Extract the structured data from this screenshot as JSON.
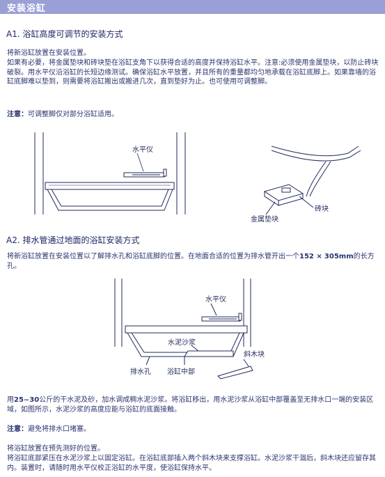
{
  "header": {
    "title": "安装浴缸"
  },
  "sectionA1": {
    "heading": "A1. 浴缸高度可调节的安装方式",
    "p1": "将新浴缸放置在安装位置。",
    "p2": "如果有必要，将金属垫块和砖块垫在浴缸支角下以获得合适的高度并保持浴缸水平。注意:必须使用金属垫块，以防止砖块破裂。用水平仪沿浴缸的长短边缘测试。确保浴缸水平放置，并且所有的重量都均匀地承载在浴缸底脚上。如果靠墙的浴缸底脚难以垫到，则需要将浴缸搬出或搬进几次，直到垫好为止。也可使用可调整脚。",
    "note_label": "注意：",
    "note_text": "可调整脚仅对部分浴缸适用。",
    "fig_label_level": "水平仪",
    "fig_label_brick": "砖块",
    "fig_label_metal_pad": "金属垫块"
  },
  "sectionA2": {
    "heading": "A2. 排水管通过地面的浴缸安装方式",
    "p1_a": "将新浴缸放置在安装位置以了解排水孔和浴缸底脚的位置。在地面合适的位置为排水管开出一个",
    "p1_dim1": "152 ×",
    "p1_dim2": "305mm",
    "p1_b": "的长方孔。",
    "fig_label_level": "水平仪",
    "fig_label_mortar": "水泥沙浆",
    "fig_label_drain": "排水孔",
    "fig_label_center": "浴缸中部",
    "fig_label_wedge": "斜木块",
    "p2_num": "25~30",
    "p2_a": "用",
    "p2_b": "公斤的干水泥及砂，加水调成稠水泥沙浆。将浴缸移出，用水泥沙浆从浴缸中部覆盖至无排水口一端的安装区域，如图所示，水泥沙浆的高度应能与浴缸的底面接触。",
    "note_label": "注意：",
    "note_text": "避免将排水口堵塞。",
    "p3": "将浴缸放置在预先测好的位置。",
    "p4": "将浴缸底部紧压在水泥沙浆上以固定浴缸。在浴缸底部插入两个斜木块来支撑浴缸。水泥沙浆干涸后，斜木块还应留存其内。装置时，请随时用水平仪校正浴缸的水平度，使浴缸保持水平。"
  }
}
